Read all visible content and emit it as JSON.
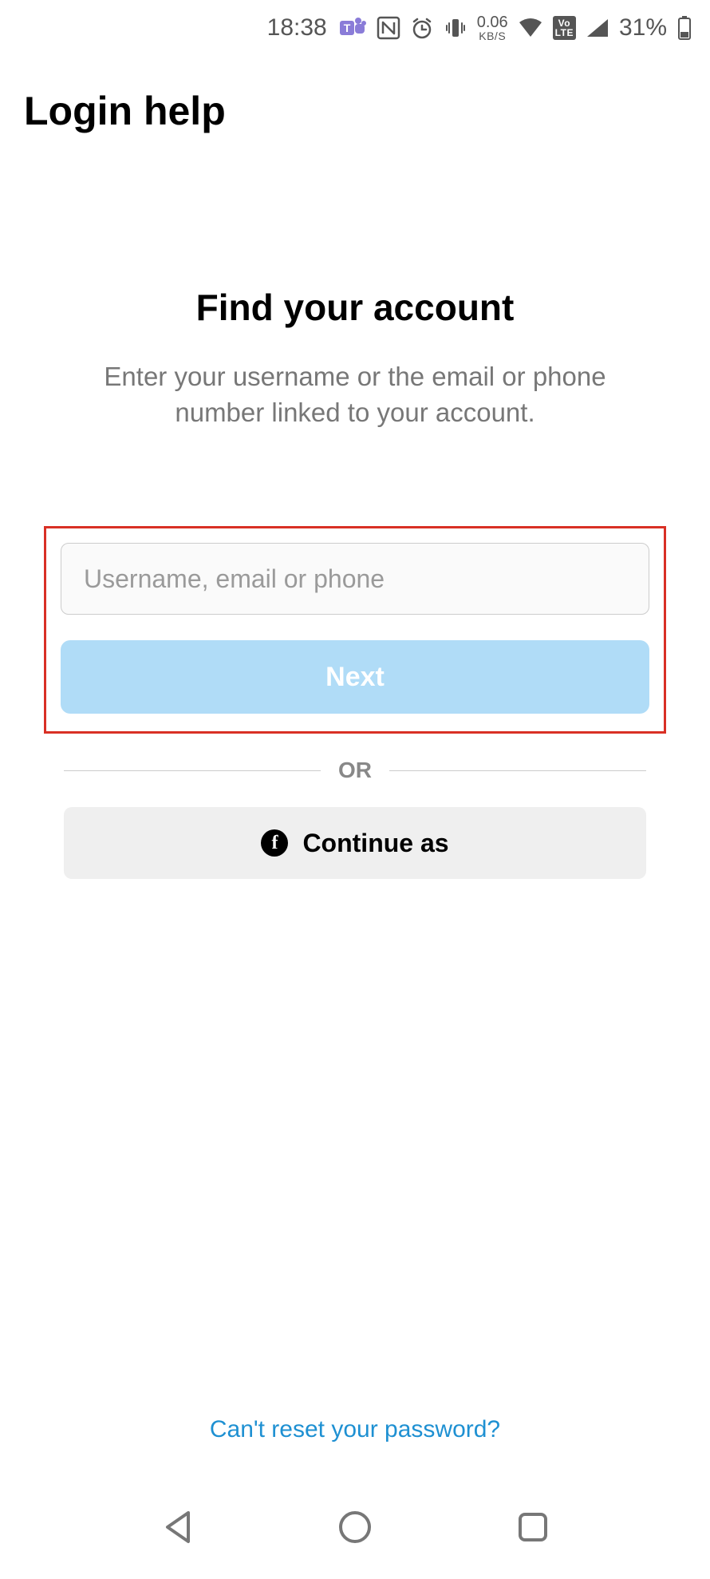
{
  "status": {
    "time": "18:38",
    "net_speed_value": "0.06",
    "net_speed_unit": "KB/S",
    "lte_top": "Vo",
    "lte_bottom": "LTE",
    "battery_text": "31%"
  },
  "header": {
    "title": "Login help"
  },
  "main": {
    "heading": "Find your account",
    "subtext": "Enter your username or the email or phone number linked to your account.",
    "input_placeholder": "Username, email or phone",
    "next_label": "Next",
    "or_label": "OR",
    "facebook_label": "Continue as",
    "cant_reset": "Can't reset your password?"
  }
}
